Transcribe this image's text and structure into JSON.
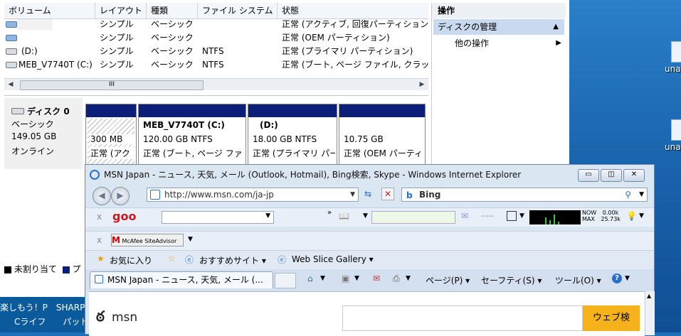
{
  "desktop": {
    "icons": [
      {
        "label": "una"
      },
      {
        "label": "una"
      }
    ]
  },
  "disk_mgmt": {
    "columns": [
      "ボリューム",
      "レイアウト",
      "種類",
      "ファイル システム",
      "状態"
    ],
    "rows": [
      {
        "volume": "",
        "layout": "シンプル",
        "type": "ベーシック",
        "fs": "",
        "status": "正常 (アクティブ, 回復パーティション"
      },
      {
        "volume": "",
        "layout": "シンプル",
        "type": "ベーシック",
        "fs": "",
        "status": "正常 (OEM パーティション)"
      },
      {
        "volume": "(D:)",
        "layout": "シンプル",
        "type": "ベーシック",
        "fs": "NTFS",
        "status": "正常 (プライマリ パーティション)"
      },
      {
        "volume": "MEB_V7740T (C:)",
        "layout": "シンプル",
        "type": "ベーシック",
        "fs": "NTFS",
        "status": "正常 (ブート, ページ ファイル, クラッ"
      }
    ],
    "scroll_thumb": "III",
    "disk": {
      "name": "ディスク 0",
      "kind": "ベーシック",
      "size": "149.05 GB",
      "state": "オンライン"
    },
    "partitions": [
      {
        "title": "",
        "size": "300 MB",
        "status": "正常 (アク"
      },
      {
        "title": "MEB_V7740T  (C:)",
        "size": "120.00 GB NTFS",
        "status": "正常 (ブート, ページ ファ"
      },
      {
        "title": "(D:)",
        "size": "18.00 GB NTFS",
        "status": "正常 (プライマリ パー"
      },
      {
        "title": "",
        "size": "10.75 GB",
        "status": "正常 (OEM パーティ"
      }
    ],
    "legend": {
      "unallocated": "未割り当て",
      "primary_prefix": "プ"
    }
  },
  "ops": {
    "title": "操作",
    "disk_mgmt": "ディスクの管理",
    "other": "他の操作"
  },
  "strip": {
    "line1": "楽しもう！P　SHARP",
    "line2": "Cライフ　　パッド"
  },
  "ie": {
    "title": "MSN Japan - ニュース, 天気, メール (Outlook, Hotmail), Bing検索, Skype - Windows Internet Explorer",
    "url": "http://www.msn.com/ja-jp",
    "search_provider": "Bing",
    "goo_logo": "goo",
    "meter": {
      "now": "0.00k",
      "max": "25.73k",
      "now_label": "NOW",
      "max_label": "MAX"
    },
    "mcafee": "McAfee SiteAdvisor",
    "favorites": "お気に入り",
    "suggested_sites": "おすすめサイト ▾",
    "web_slice": "Web Slice Gallery ▾",
    "tab": "MSN Japan - ニュース, 天気, メール (...",
    "cmd": {
      "page": "ページ(P) ▾",
      "safety": "セーフティ(S) ▾",
      "tools": "ツール(O) ▾"
    },
    "msn_logo": "msn",
    "search_button": "ウェブ検"
  },
  "colors": {
    "accent": "#0b1f7a",
    "ops_highlight": "#c9daf0",
    "msn_button": "#f5b21b"
  }
}
